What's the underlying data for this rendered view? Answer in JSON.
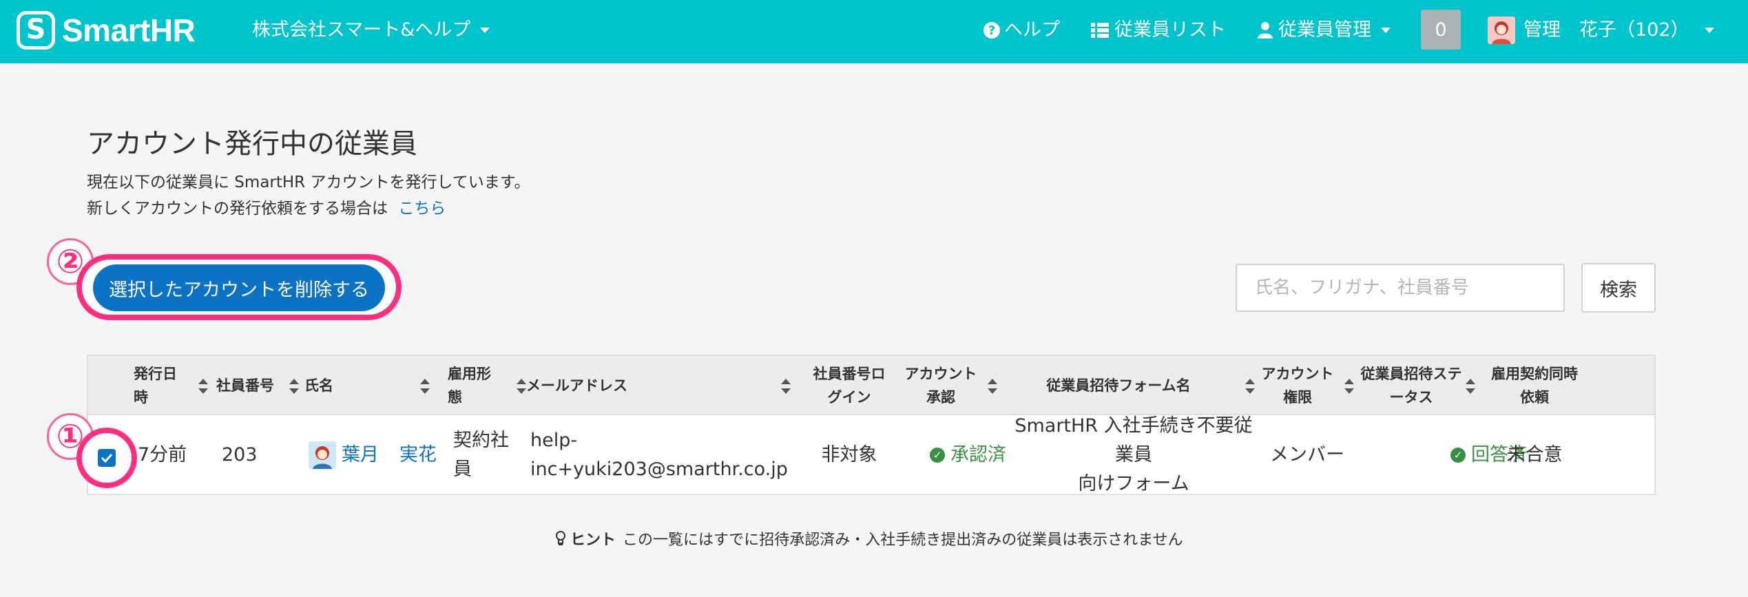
{
  "header": {
    "brand": "SmartHR",
    "brand_mark": "S",
    "company": "株式会社スマート&ヘルプ",
    "help_label": "ヘルプ",
    "employee_list_label": "従業員リスト",
    "employee_mgmt_label": "従業員管理",
    "notification_count": "0",
    "user_name": "管理　花子（102）",
    "accent_color": "#00c4cc"
  },
  "page": {
    "title": "アカウント発行中の従業員",
    "desc_line1": "現在以下の従業員に SmartHR アカウントを発行しています。",
    "desc_line2_prefix": "新しくアカウントの発行依頼をする場合は",
    "desc_link": "こちら"
  },
  "actions": {
    "delete_label": "選択したアカウントを削除する",
    "search_placeholder": "氏名、フリガナ、社員番号",
    "search_button": "検索"
  },
  "annotations": {
    "step1": "①",
    "step2": "②",
    "highlight_color": "#ff2f80"
  },
  "table": {
    "headers": {
      "issued_at": "発行日時",
      "emp_no": "社員番号",
      "name": "氏名",
      "employment_type": "雇用形態",
      "email": "メールアドレス",
      "emp_no_login": "社員番号ログイン",
      "account_approval": "アカウント承認",
      "invite_form": "従業員招待フォーム名",
      "account_role": "アカウント権限",
      "invite_status": "従業員招待ステータス",
      "contract_request": "雇用契約同時依頼"
    },
    "rows": [
      {
        "selected": true,
        "issued_at": "7分前",
        "emp_no": "203",
        "last_name": "葉月",
        "first_name": "実花",
        "employment_type": "契約社員",
        "email_line1": "help-",
        "email_line2": "inc+yuki203@smarthr.co.jp",
        "emp_no_login": "非対象",
        "account_approval": "承認済",
        "invite_form_line1": "SmartHR 入社手続き不要従業員",
        "invite_form_line2": "向けフォーム",
        "account_role": "メンバー",
        "invite_status": "回答済",
        "contract_request": "未合意"
      }
    ]
  },
  "hint": {
    "label": "ヒント",
    "text": "この一覧にはすでに招待承認済み・入社手続き提出済みの従業員は表示されません"
  }
}
